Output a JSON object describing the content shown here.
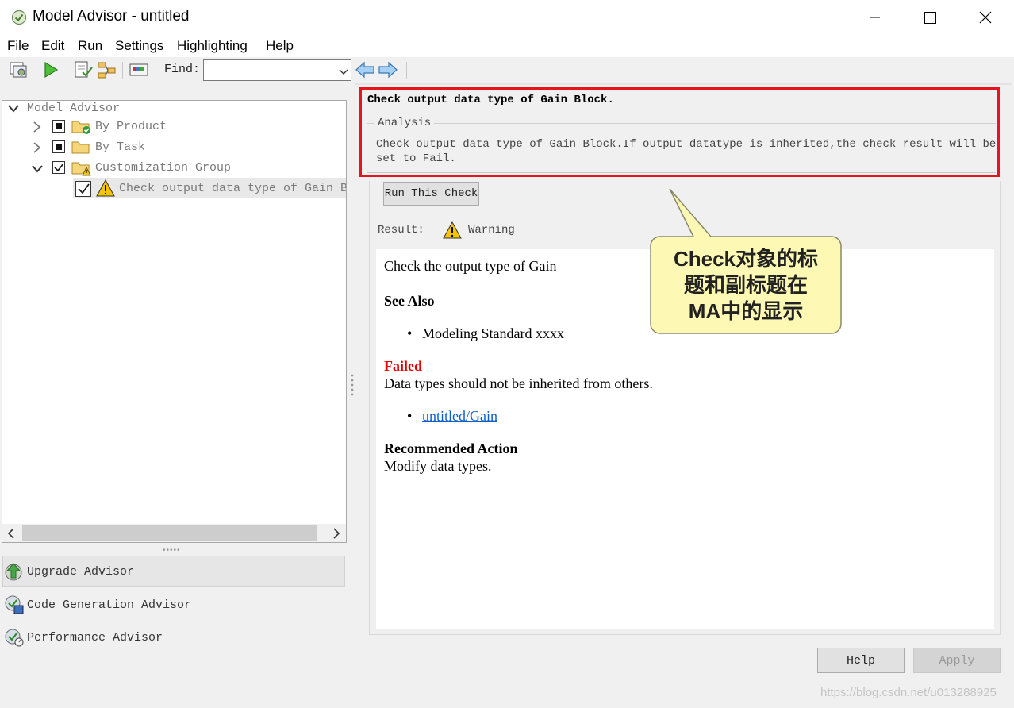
{
  "window": {
    "title": "Model Advisor - untitled",
    "controls": {
      "minimize": "─",
      "maximize": "☐",
      "close": "✕"
    }
  },
  "menu": [
    "File",
    "Edit",
    "Run",
    "Settings",
    "Highlighting",
    "Help"
  ],
  "toolbar": {
    "find_label": "Find:",
    "find_value": ""
  },
  "tree": {
    "root": "Model Advisor",
    "items": [
      {
        "label": "By Product"
      },
      {
        "label": "By Task"
      },
      {
        "label": "Customization Group"
      },
      {
        "label": "Check output data type of Gain Block"
      }
    ]
  },
  "advisors": [
    "Upgrade Advisor",
    "Code Generation Advisor",
    "Performance Advisor"
  ],
  "check": {
    "title": "Check output data type of Gain Block.",
    "analysis_label": "Analysis",
    "analysis_text": "Check output data type of Gain Block.If output datatype is inherited,the check result will be set to Fail.",
    "run_button": "Run This Check",
    "result_label": "Result:",
    "result_value": "Warning"
  },
  "report": {
    "intro": "Check the output type of Gain",
    "see_also_heading": "See Also",
    "see_also_item": "Modeling Standard xxxx",
    "failed_label": "Failed",
    "failed_text": "Data types should not be inherited from others.",
    "link": "untitled/Gain",
    "recommended_heading": "Recommended Action",
    "recommended_text": "Modify data types."
  },
  "callout": {
    "line1": "Check对象的标",
    "line2": "题和副标题在",
    "line3": "MA中的显示"
  },
  "buttons": {
    "help": "Help",
    "apply": "Apply"
  },
  "watermark": "https://blog.csdn.net/u013288925",
  "colors": {
    "highlight_border": "#e8141c",
    "failed": "#e00000",
    "link": "#0b5fcc",
    "callout_bg": "#fdf9b4"
  }
}
